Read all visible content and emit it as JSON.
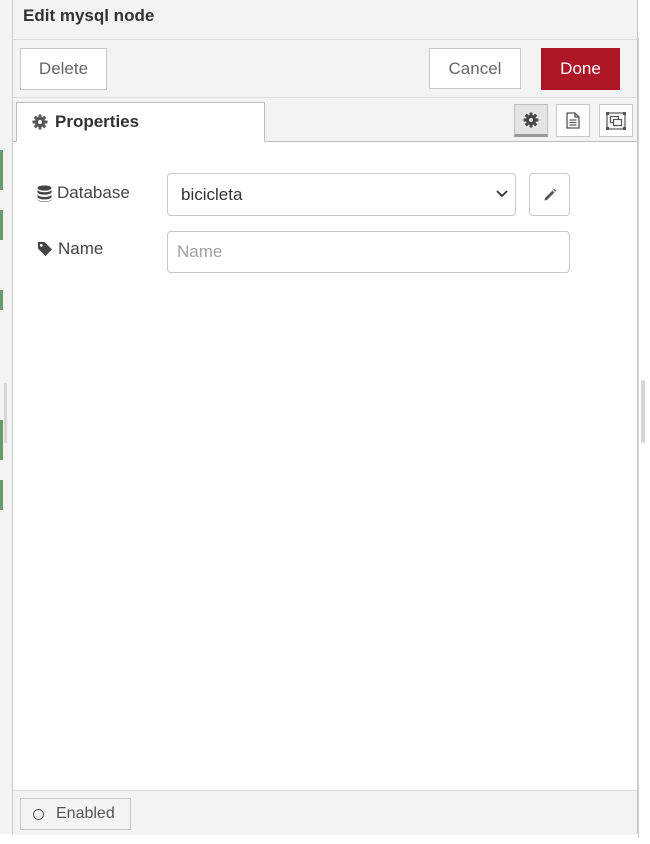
{
  "dialog": {
    "title": "Edit mysql node"
  },
  "toolbar": {
    "delete_label": "Delete",
    "cancel_label": "Cancel",
    "done_label": "Done"
  },
  "tabs": [
    {
      "label": "Properties",
      "icon": "gear-icon",
      "active": true
    }
  ],
  "tab_tools": [
    {
      "icon": "gear-icon",
      "active": true
    },
    {
      "icon": "document-icon",
      "active": false
    },
    {
      "icon": "appearance-icon",
      "active": false
    }
  ],
  "form": {
    "database": {
      "label": "Database",
      "icon": "database-icon",
      "selected": "bicicleta"
    },
    "name": {
      "label": "Name",
      "icon": "tag-icon",
      "value": "",
      "placeholder": "Name"
    }
  },
  "footer": {
    "enabled_label": "Enabled"
  },
  "colors": {
    "done_button": "#ad1625",
    "panel_background": "#f3f3f3",
    "border": "#c8c8c8"
  }
}
